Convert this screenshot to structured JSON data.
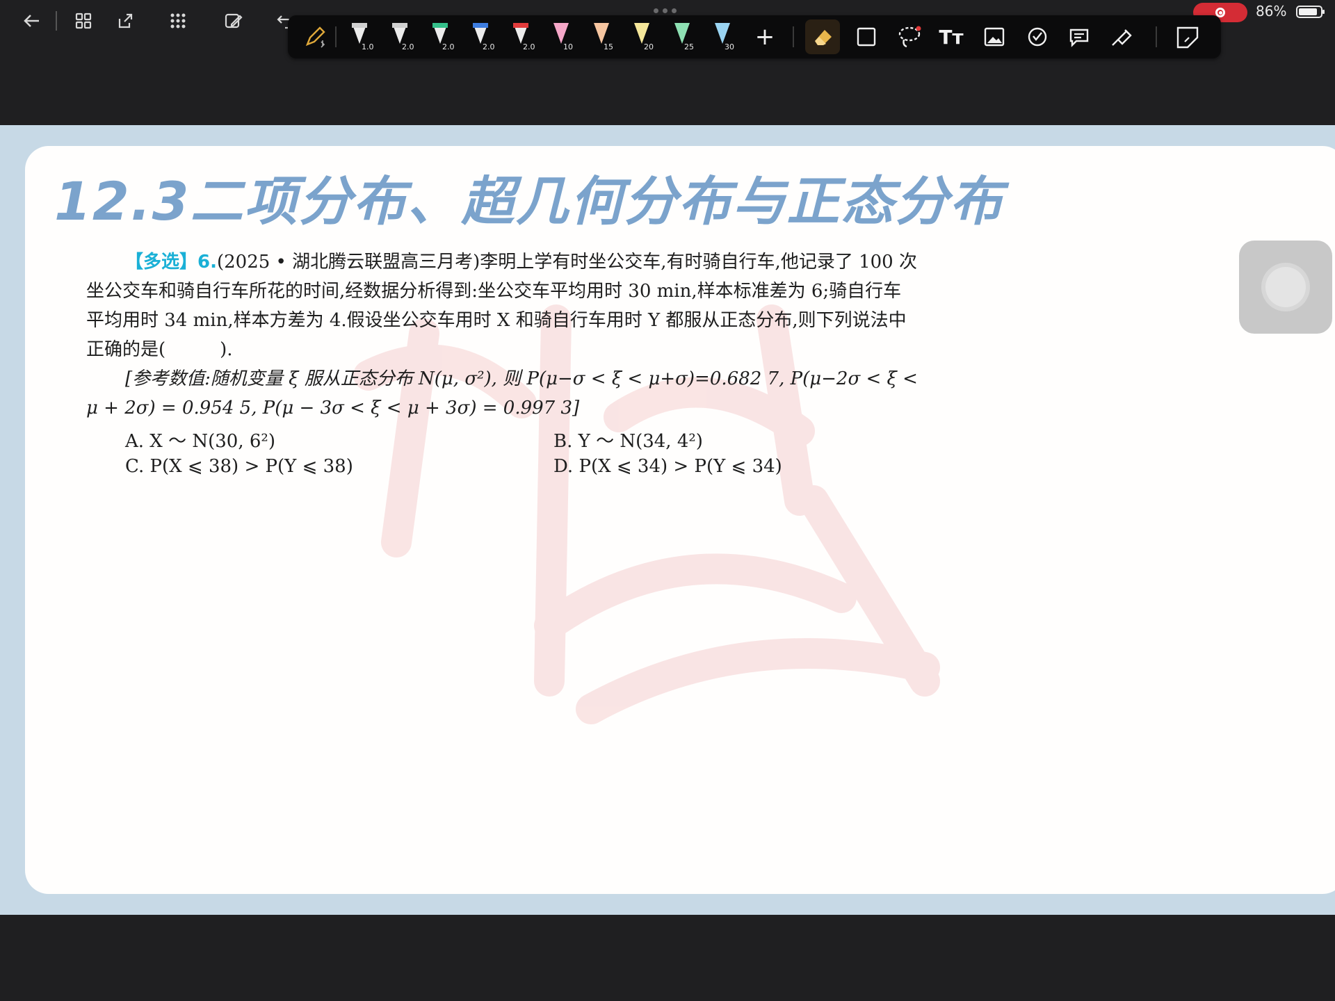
{
  "topbar": {
    "icons": [
      "back-arrow-icon",
      "grid-icon",
      "export-icon",
      "apps-icon",
      "edit-doc-icon",
      "undo-icon"
    ],
    "recording_active": true,
    "battery_percent": "86%"
  },
  "toolbar": {
    "pens": [
      {
        "size": "1.0",
        "color": "#ececec"
      },
      {
        "size": "2.0",
        "color": "#ececec"
      },
      {
        "size": "2.0",
        "color": "#34c08a"
      },
      {
        "size": "2.0",
        "color": "#3d7de0"
      },
      {
        "size": "2.0",
        "color": "#e13b3b"
      }
    ],
    "markers": [
      {
        "size": "10",
        "color": "#f5a7c8"
      },
      {
        "size": "15",
        "color": "#f6c5a0"
      },
      {
        "size": "20",
        "color": "#f5e79a"
      },
      {
        "size": "25",
        "color": "#8ee0b3"
      },
      {
        "size": "30",
        "color": "#9ad4f2"
      }
    ],
    "add_label": "+",
    "text_tool_label": "Tт"
  },
  "document": {
    "heading": "12.3二项分布、超几何分布与正态分布",
    "question": {
      "tag": "【多选】6.",
      "line1": "(2025 • 湖北腾云联盟高三月考)李明上学有时坐公交车,有时骑自行车,他记录了 100 次",
      "line2": "坐公交车和骑自行车所花的时间,经数据分析得到:坐公交车平均用时 30 min,样本标准差为 6;骑自行车",
      "line3": "平均用时 34 min,样本方差为 4.假设坐公交车用时 X 和骑自行车用时 Y 都服从正态分布,则下列说法中",
      "line4": "正确的是(　　　).",
      "ref1": "[参考数值:随机变量 ξ 服从正态分布 N(μ, σ²), 则 P(μ−σ < ξ < μ+σ)=0.682 7, P(μ−2σ < ξ <",
      "ref2": "μ + 2σ) = 0.954 5, P(μ − 3σ < ξ < μ + 3σ) = 0.997 3]"
    },
    "options": {
      "A": "A.  X ～ N(30, 6²)",
      "B": "B.  Y ～ N(34, 4²)",
      "C": "C.  P(X ⩽ 38) > P(Y ⩽ 38)",
      "D": "D.  P(X ⩽ 34) > P(Y ⩽ 34)"
    }
  }
}
